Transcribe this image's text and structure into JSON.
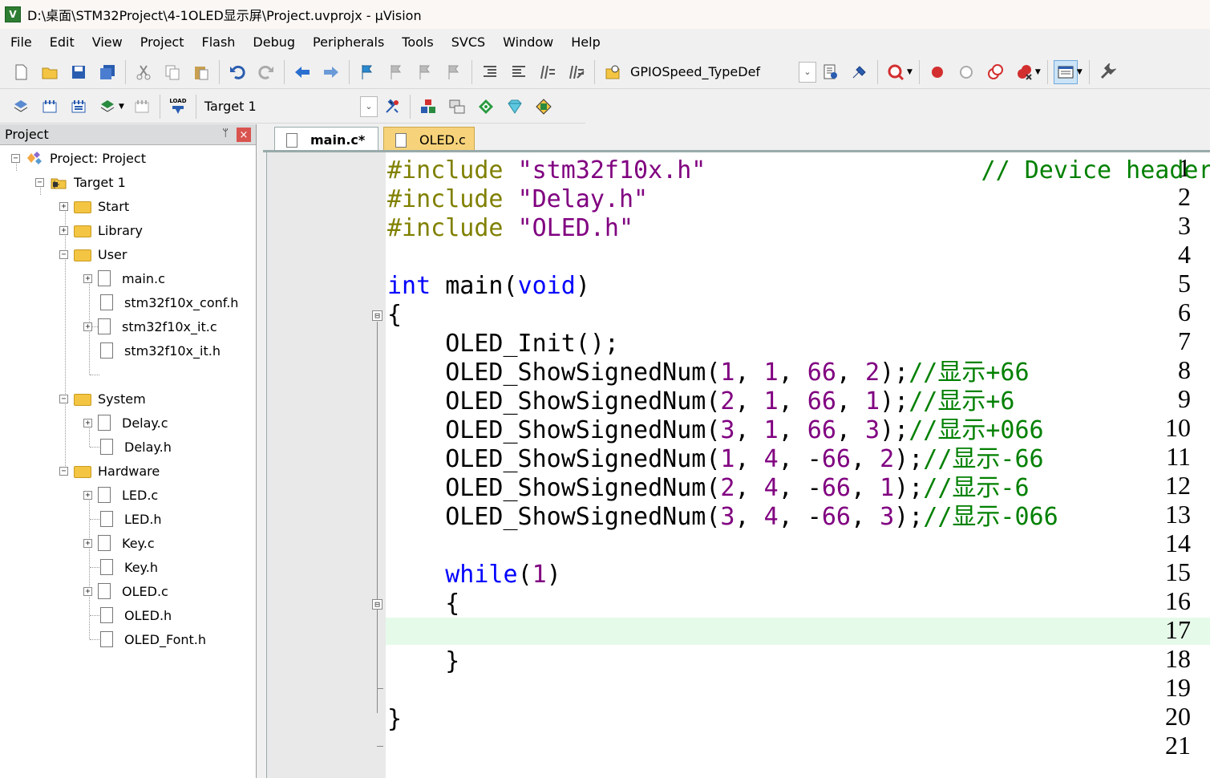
{
  "window": {
    "title": "D:\\桌面\\STM32Project\\4-1OLED显示屏\\Project.uvprojx - µVision",
    "app_icon_letter": "V"
  },
  "menu": [
    "File",
    "Edit",
    "View",
    "Project",
    "Flash",
    "Debug",
    "Peripherals",
    "Tools",
    "SVCS",
    "Window",
    "Help"
  ],
  "toolbar": {
    "find_combo_value": "GPIOSpeed_TypeDef",
    "target_combo_value": "Target 1",
    "load_label": "LOAD"
  },
  "project_panel": {
    "title": "Project",
    "pin_glyph": "ᛘ",
    "close_glyph": "×",
    "tree": [
      {
        "label": "Project: Project",
        "kind": "project"
      },
      {
        "label": "Target 1",
        "kind": "target"
      },
      {
        "label": "Start",
        "kind": "folder"
      },
      {
        "label": "Library",
        "kind": "folder"
      },
      {
        "label": "User",
        "kind": "folder"
      },
      {
        "label": "main.c",
        "kind": "file"
      },
      {
        "label": "stm32f10x_conf.h",
        "kind": "file"
      },
      {
        "label": "stm32f10x_it.c",
        "kind": "file"
      },
      {
        "label": "stm32f10x_it.h",
        "kind": "file"
      },
      {
        "label": "System",
        "kind": "folder"
      },
      {
        "label": "Delay.c",
        "kind": "file"
      },
      {
        "label": "Delay.h",
        "kind": "file"
      },
      {
        "label": "Hardware",
        "kind": "folder"
      },
      {
        "label": "LED.c",
        "kind": "file"
      },
      {
        "label": "LED.h",
        "kind": "file"
      },
      {
        "label": "Key.c",
        "kind": "file"
      },
      {
        "label": "Key.h",
        "kind": "file"
      },
      {
        "label": "OLED.c",
        "kind": "file"
      },
      {
        "label": "OLED.h",
        "kind": "file"
      },
      {
        "label": "OLED_Font.h",
        "kind": "file"
      }
    ]
  },
  "tabs": [
    {
      "label": "main.c*",
      "active": true
    },
    {
      "label": "OLED.c",
      "active": false
    }
  ],
  "editor": {
    "line_numbers": [
      "1",
      "2",
      "3",
      "4",
      "5",
      "6",
      "7",
      "8",
      "9",
      "10",
      "11",
      "12",
      "13",
      "14",
      "15",
      "16",
      "17",
      "18",
      "19",
      "20",
      "21"
    ],
    "current_line": 17,
    "fold_markers": [
      "⊟",
      "⊟"
    ],
    "lines": [
      [
        {
          "t": "#include ",
          "c": "pp"
        },
        {
          "t": "\"stm32f10x.h\"",
          "c": "str"
        },
        {
          "t": "                   // Device header",
          "c": "cm"
        }
      ],
      [
        {
          "t": "#include ",
          "c": "pp"
        },
        {
          "t": "\"Delay.h\"",
          "c": "str"
        }
      ],
      [
        {
          "t": "#include ",
          "c": "pp"
        },
        {
          "t": "\"OLED.h\"",
          "c": "str"
        }
      ],
      [],
      [
        {
          "t": "int",
          "c": "kw"
        },
        {
          "t": " main(",
          "c": "fn"
        },
        {
          "t": "void",
          "c": "kw"
        },
        {
          "t": ")",
          "c": "fn"
        }
      ],
      [
        {
          "t": "{",
          "c": "fn"
        }
      ],
      [
        {
          "t": "    OLED_Init();",
          "c": "fn"
        }
      ],
      [
        {
          "t": "    OLED_ShowSignedNum(",
          "c": "fn"
        },
        {
          "t": "1",
          "c": "num"
        },
        {
          "t": ", ",
          "c": "fn"
        },
        {
          "t": "1",
          "c": "num"
        },
        {
          "t": ", ",
          "c": "fn"
        },
        {
          "t": "66",
          "c": "num"
        },
        {
          "t": ", ",
          "c": "fn"
        },
        {
          "t": "2",
          "c": "num"
        },
        {
          "t": ");",
          "c": "fn"
        },
        {
          "t": "//显示+66",
          "c": "cm"
        }
      ],
      [
        {
          "t": "    OLED_ShowSignedNum(",
          "c": "fn"
        },
        {
          "t": "2",
          "c": "num"
        },
        {
          "t": ", ",
          "c": "fn"
        },
        {
          "t": "1",
          "c": "num"
        },
        {
          "t": ", ",
          "c": "fn"
        },
        {
          "t": "66",
          "c": "num"
        },
        {
          "t": ", ",
          "c": "fn"
        },
        {
          "t": "1",
          "c": "num"
        },
        {
          "t": ");",
          "c": "fn"
        },
        {
          "t": "//显示+6",
          "c": "cm"
        }
      ],
      [
        {
          "t": "    OLED_ShowSignedNum(",
          "c": "fn"
        },
        {
          "t": "3",
          "c": "num"
        },
        {
          "t": ", ",
          "c": "fn"
        },
        {
          "t": "1",
          "c": "num"
        },
        {
          "t": ", ",
          "c": "fn"
        },
        {
          "t": "66",
          "c": "num"
        },
        {
          "t": ", ",
          "c": "fn"
        },
        {
          "t": "3",
          "c": "num"
        },
        {
          "t": ");",
          "c": "fn"
        },
        {
          "t": "//显示+066",
          "c": "cm"
        }
      ],
      [
        {
          "t": "    OLED_ShowSignedNum(",
          "c": "fn"
        },
        {
          "t": "1",
          "c": "num"
        },
        {
          "t": ", ",
          "c": "fn"
        },
        {
          "t": "4",
          "c": "num"
        },
        {
          "t": ", -",
          "c": "fn"
        },
        {
          "t": "66",
          "c": "num"
        },
        {
          "t": ", ",
          "c": "fn"
        },
        {
          "t": "2",
          "c": "num"
        },
        {
          "t": ");",
          "c": "fn"
        },
        {
          "t": "//显示-66",
          "c": "cm"
        }
      ],
      [
        {
          "t": "    OLED_ShowSignedNum(",
          "c": "fn"
        },
        {
          "t": "2",
          "c": "num"
        },
        {
          "t": ", ",
          "c": "fn"
        },
        {
          "t": "4",
          "c": "num"
        },
        {
          "t": ", -",
          "c": "fn"
        },
        {
          "t": "66",
          "c": "num"
        },
        {
          "t": ", ",
          "c": "fn"
        },
        {
          "t": "1",
          "c": "num"
        },
        {
          "t": ");",
          "c": "fn"
        },
        {
          "t": "//显示-6",
          "c": "cm"
        }
      ],
      [
        {
          "t": "    OLED_ShowSignedNum(",
          "c": "fn"
        },
        {
          "t": "3",
          "c": "num"
        },
        {
          "t": ", ",
          "c": "fn"
        },
        {
          "t": "4",
          "c": "num"
        },
        {
          "t": ", -",
          "c": "fn"
        },
        {
          "t": "66",
          "c": "num"
        },
        {
          "t": ", ",
          "c": "fn"
        },
        {
          "t": "3",
          "c": "num"
        },
        {
          "t": ");",
          "c": "fn"
        },
        {
          "t": "//显示-066",
          "c": "cm"
        }
      ],
      [],
      [
        {
          "t": "    ",
          "c": "fn"
        },
        {
          "t": "while",
          "c": "kw"
        },
        {
          "t": "(",
          "c": "fn"
        },
        {
          "t": "1",
          "c": "num"
        },
        {
          "t": ")",
          "c": "fn"
        }
      ],
      [
        {
          "t": "    {",
          "c": "fn"
        }
      ],
      [],
      [
        {
          "t": "    }",
          "c": "fn"
        }
      ],
      [],
      [
        {
          "t": "}",
          "c": "fn"
        }
      ],
      []
    ]
  },
  "colors": {
    "preprocessor": "#808000",
    "string": "#800080",
    "keyword": "#0000ff",
    "comment": "#008000",
    "number": "#800080",
    "current_line_bg": "#e6faea",
    "gutter_bg": "#e9e9e9"
  }
}
